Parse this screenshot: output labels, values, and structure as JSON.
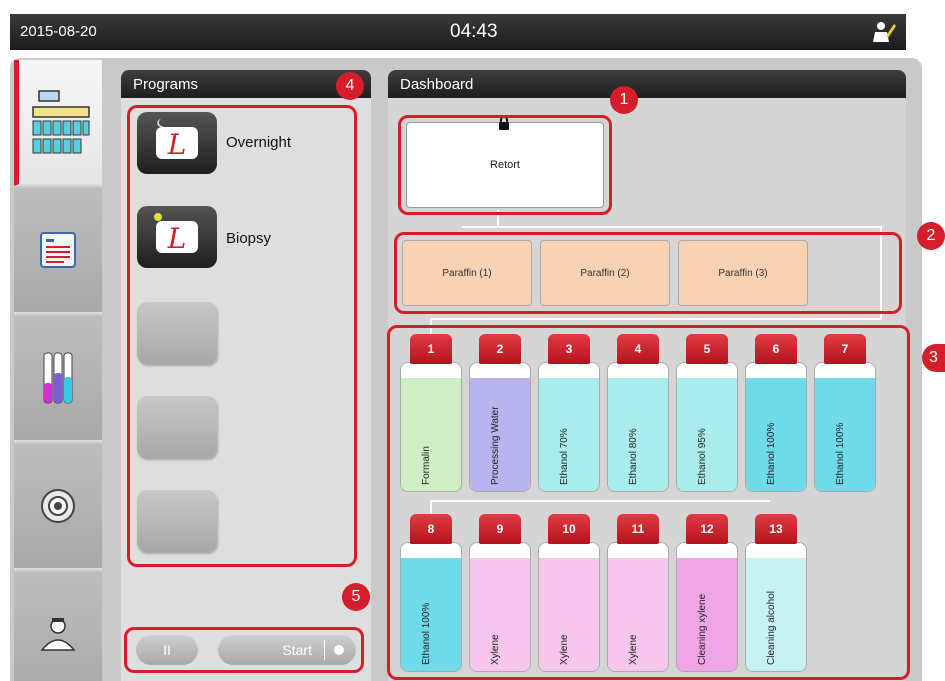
{
  "header": {
    "date": "2015-08-20",
    "time": "04:43"
  },
  "nav": {
    "items": [
      "dashboard",
      "reagents-list",
      "reagent-status",
      "settings",
      "user"
    ]
  },
  "programs": {
    "title": "Programs",
    "items": [
      {
        "label": "Overnight"
      },
      {
        "label": "Biopsy"
      }
    ]
  },
  "dashboard": {
    "title": "Dashboard",
    "retort": "Retort",
    "paraffin": [
      "Paraffin (1)",
      "Paraffin (2)",
      "Paraffin (3)"
    ],
    "bottles_row1": [
      {
        "num": "1",
        "label": "Formalin",
        "color": "#cfeec6"
      },
      {
        "num": "2",
        "label": "Processing Water",
        "color": "#b7b4f0"
      },
      {
        "num": "3",
        "label": "Ethanol 70%",
        "color": "#a9ecec"
      },
      {
        "num": "4",
        "label": "Ethanol 80%",
        "color": "#a9ecec"
      },
      {
        "num": "5",
        "label": "Ethanol 95%",
        "color": "#a9ecec"
      },
      {
        "num": "6",
        "label": "Ethanol 100%",
        "color": "#6fdbe8"
      },
      {
        "num": "7",
        "label": "Ethanol 100%",
        "color": "#6fdbe8"
      }
    ],
    "bottles_row2": [
      {
        "num": "8",
        "label": "Ethanol 100%",
        "color": "#6fdbe8"
      },
      {
        "num": "9",
        "label": "Xylene",
        "color": "#f6c6ec"
      },
      {
        "num": "10",
        "label": "Xylene",
        "color": "#f6c6ec"
      },
      {
        "num": "11",
        "label": "Xylene",
        "color": "#f6c6ec"
      },
      {
        "num": "12",
        "label": "Cleaning xylene",
        "color": "#f0a6e6"
      },
      {
        "num": "13",
        "label": "Cleaning alcohol",
        "color": "#c7f2f2"
      }
    ]
  },
  "controls": {
    "pause": "II",
    "start": "Start"
  },
  "callouts": [
    "1",
    "2",
    "3",
    "4",
    "5"
  ]
}
